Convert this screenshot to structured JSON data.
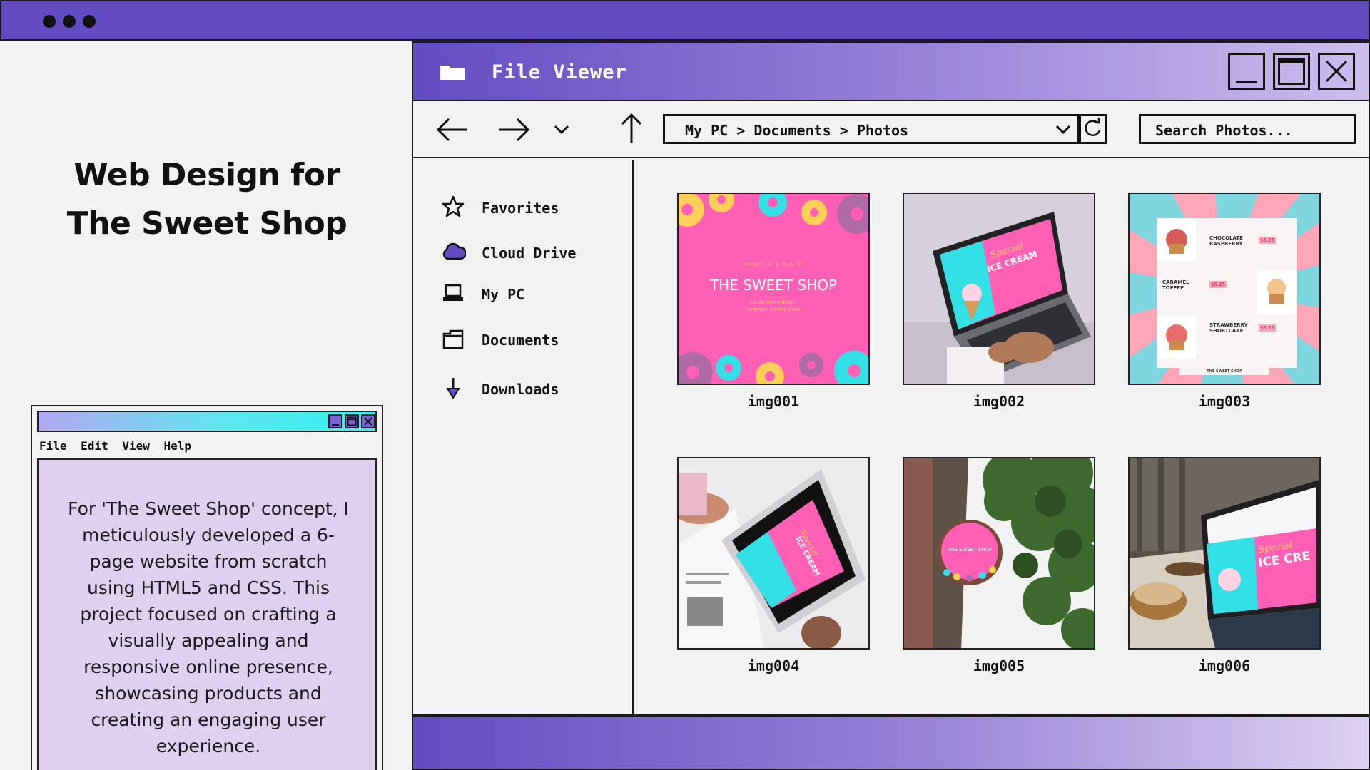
{
  "colors": {
    "accent": "#634cc1",
    "note_bg": "#dfd0ef",
    "pink": "#ff5fb4",
    "cyan": "#33e0e6"
  },
  "headline": {
    "line1": "Web Design for",
    "line2": "The Sweet Shop"
  },
  "notepad": {
    "menu": [
      "File",
      "Edit",
      "View",
      "Help"
    ],
    "text": "For 'The Sweet Shop' concept, I meticulously developed a 6-page website from scratch using HTML5 and CSS. This project focused on crafting a visually appealing and responsive online presence, showcasing products and creating an engaging user experience."
  },
  "viewer": {
    "title": "File Viewer",
    "address": "My PC > Documents > Photos",
    "search_placeholder": "Search Photos...",
    "sidebar": [
      {
        "label": "Favorites",
        "icon": "star-icon"
      },
      {
        "label": "Cloud Drive",
        "icon": "cloud-icon"
      },
      {
        "label": "My PC",
        "icon": "laptop-icon"
      },
      {
        "label": "Documents",
        "icon": "folder-icon"
      },
      {
        "label": "Downloads",
        "icon": "download-arrow-icon"
      }
    ],
    "files": [
      {
        "name": "img001",
        "thumb_title": "THE SWEET SHOP",
        "thumb_top": "FANCY A BISCUIT",
        "thumb_line1": "Go on and indulge-",
        "thumb_line2": "I promise it's my treat!"
      },
      {
        "name": "img002",
        "thumb_screen": "ICE CREAM",
        "thumb_script": "Special"
      },
      {
        "name": "img003",
        "menu": [
          {
            "title": "CHOCOLATE RASPBERRY",
            "price": "$5.25"
          },
          {
            "title": "CARAMEL TOFFEE",
            "price": "$5.25"
          },
          {
            "title": "STRAWBERRY SHORTCAKE",
            "price": "$5.25"
          }
        ],
        "footer": "THE SWEET SHOP"
      },
      {
        "name": "img004",
        "thumb_screen": "ICE CREAM",
        "thumb_script": "Special"
      },
      {
        "name": "img005",
        "sign": "THE SWEET SHOP"
      },
      {
        "name": "img006",
        "thumb_screen": "ICE CRE",
        "thumb_script": "Special"
      }
    ]
  }
}
